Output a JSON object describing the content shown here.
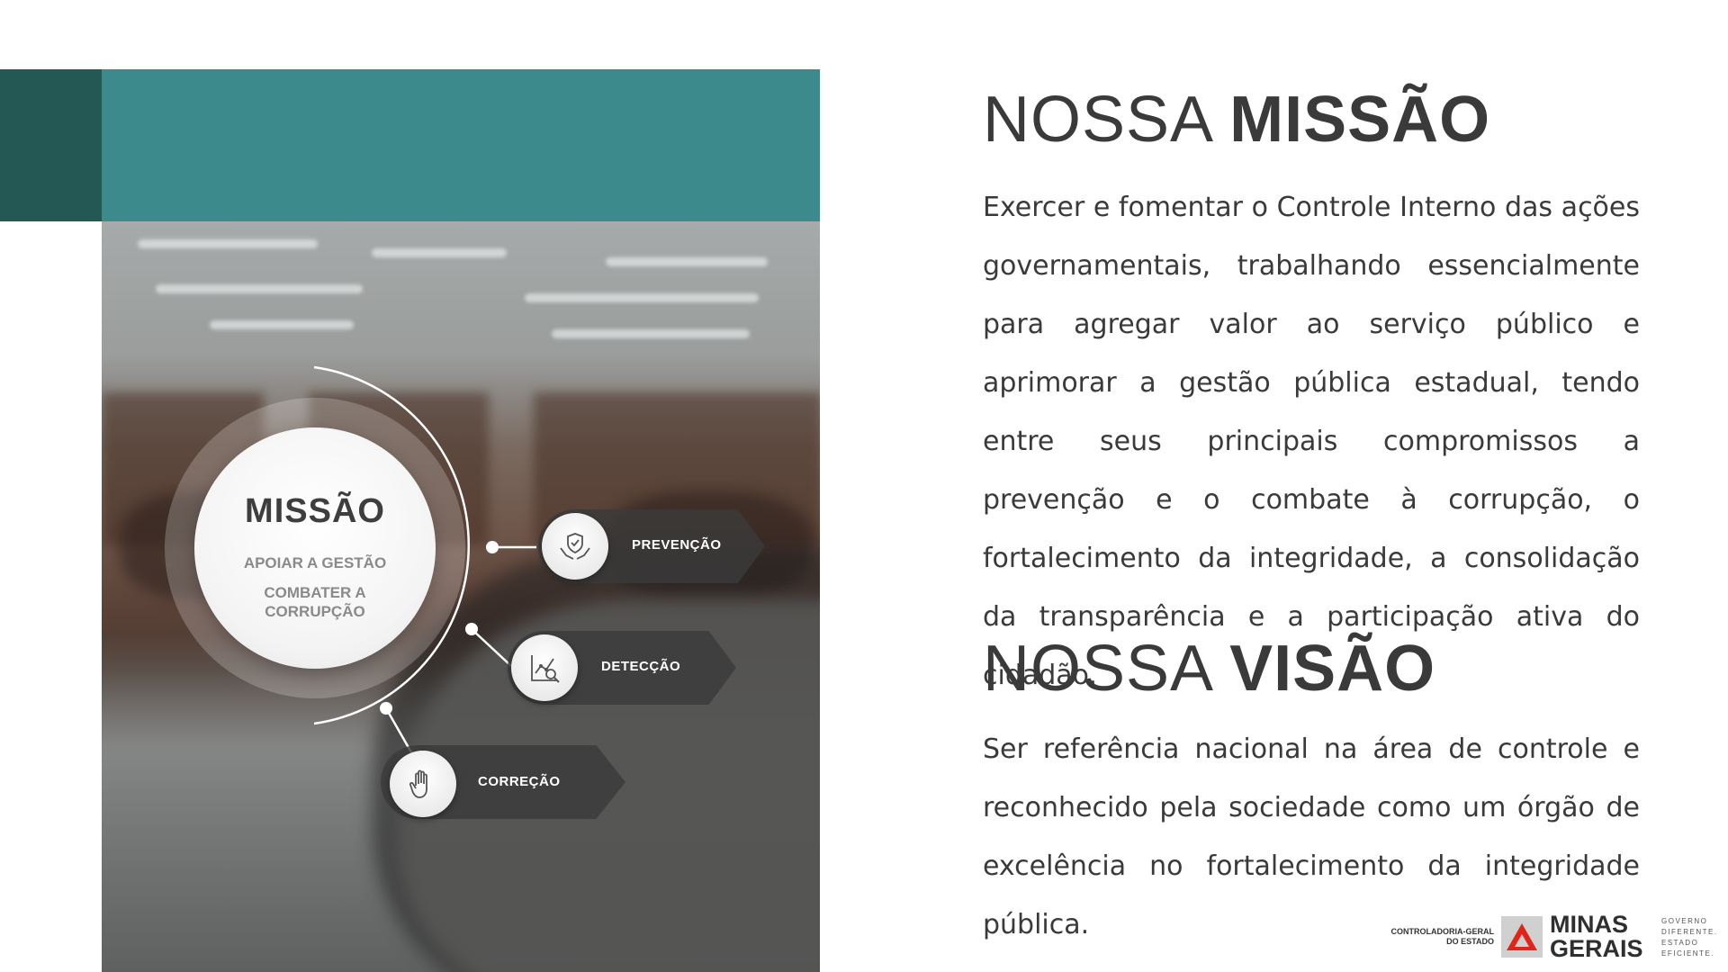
{
  "mission_graphic": {
    "title": "MISSÃO",
    "line1": "APOIAR A GESTÃO",
    "line2a": "COMBATER A",
    "line2b": "CORRUPÇÃO",
    "pillars": [
      {
        "label": "PREVENÇÃO",
        "icon": "shield-hands-icon"
      },
      {
        "label": "DETECÇÃO",
        "icon": "chart-magnifier-icon"
      },
      {
        "label": "CORREÇÃO",
        "icon": "raised-hand-icon"
      }
    ]
  },
  "mission": {
    "heading_light": "NOSSA",
    "heading_bold": "MISSÃO",
    "text": "Exercer e fomentar o Controle Interno das ações governamentais, trabalhando essencialmente para agregar valor ao serviço público e aprimorar a gestão pública estadual, tendo entre seus principais compromissos a prevenção e o combate à corrupção, o fortalecimento da integridade, a consolidação da transparência e a participação ativa do cidadão."
  },
  "vision": {
    "heading_light": "NOSSA",
    "heading_bold": "VISÃO",
    "text": "Ser referência nacional na área de controle e reconhecido pela sociedade como um órgão de excelência no fortalecimento da integridade pública."
  },
  "footer": {
    "cge_line1": "CONTROLADORIA-GERAL",
    "cge_line2": "DO ESTADO",
    "mg_line1": "MINAS",
    "mg_line2": "GERAIS",
    "slogan": [
      "GOVERNO",
      "DIFERENTE.",
      "ESTADO",
      "EFICIENTE."
    ]
  },
  "colors": {
    "teal_dark": "#245855",
    "teal": "#3c8a8b",
    "text": "#3a3a3a",
    "mg_red": "#e2231a"
  }
}
